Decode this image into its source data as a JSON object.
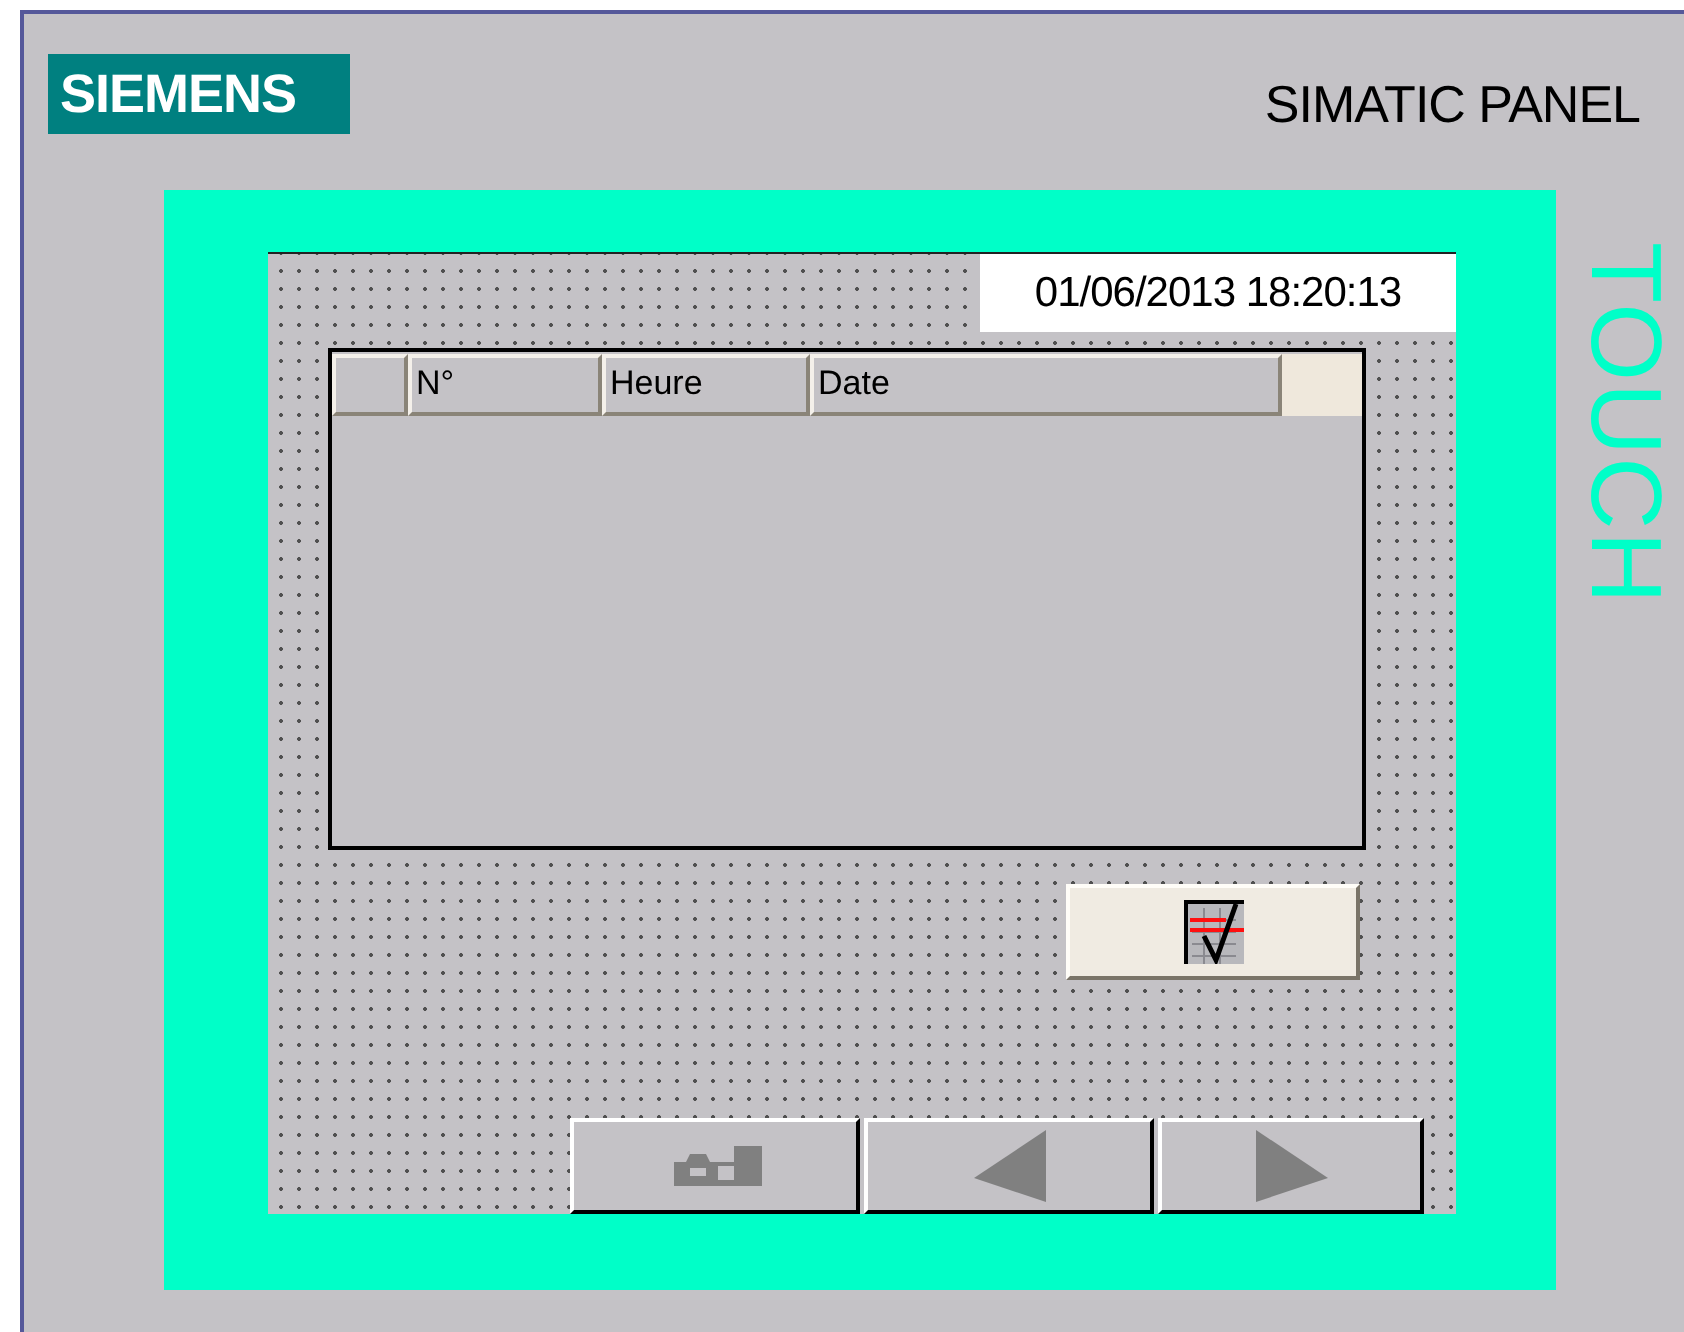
{
  "header": {
    "brand": "SIEMENS",
    "title": "SIMATIC PANEL"
  },
  "side_label": "TOUCH",
  "screen": {
    "clock": "01/06/2013 18:20:13",
    "table": {
      "columns": [
        "N°",
        "Heure",
        "Date"
      ]
    }
  }
}
